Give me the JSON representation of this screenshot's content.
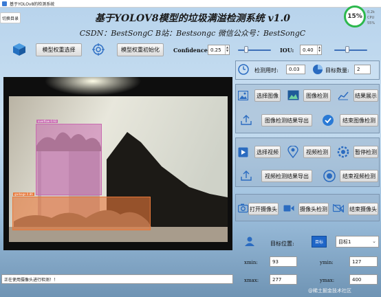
{
  "window": {
    "title": "基于YOLOv8的检测系统"
  },
  "menu_button": "切换目录",
  "header": {
    "title": "基于YOLOV8模型的垃圾满溢检测系统 v1.0",
    "subtitle": "CSDN：BestSongC  B站：Bestsongc  微信公众号：BestSongC"
  },
  "cpu": {
    "percent": "15%",
    "up": "0.2k",
    "cpu_label": "CPU 55%"
  },
  "model": {
    "select_label": "模型权重选择",
    "init_label": "模型权重初始化",
    "confidence_label": "Confidence:",
    "confidence_value": "0.25",
    "confidence_slider": 0.25,
    "iou_label": "IOU:",
    "iou_value": "0.40",
    "iou_slider": 0.4
  },
  "detection_info": {
    "time_label": "检测用时:",
    "time_value": "0.03",
    "count_label": "目标数量:",
    "count_value": "2"
  },
  "image_controls": {
    "select": "选择图像",
    "detect": "图像检测",
    "show": "结果展示",
    "export": "图像检测结果导出",
    "end": "结束图像检测"
  },
  "video_controls": {
    "select": "选择视频",
    "detect": "视频检测",
    "pause": "暂停检测",
    "export": "视频检测结果导出",
    "end": "结束视频检测"
  },
  "camera_controls": {
    "open": "打开摄像头",
    "detect": "摄像头检测",
    "end": "结束摄像头"
  },
  "target": {
    "label": "目标位置:",
    "select_value": "目标1",
    "xmin_label": "xmin:",
    "xmin_value": "93",
    "ymin_label": "ymin:",
    "ymin_value": "127",
    "xmax_label": "xmax:",
    "xmax_value": "277",
    "ymax_label": "ymax:",
    "ymax_value": "400"
  },
  "detections": [
    {
      "label": "overflow 0.93",
      "color": "#c86bb0"
    },
    {
      "label": "garbage 0.86",
      "color": "#e8783a"
    }
  ],
  "status": "正在使用摄像头进行检测！！",
  "watermark": "@稀土掘金技术社区"
}
